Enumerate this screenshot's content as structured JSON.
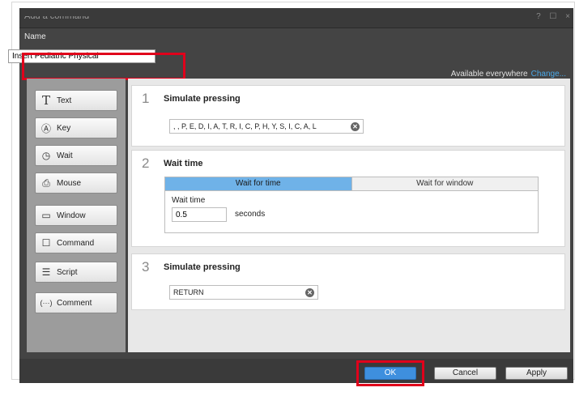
{
  "window": {
    "title": "Add a command",
    "controls": [
      "?",
      "☐",
      "×"
    ]
  },
  "name": {
    "label": "Name",
    "value": "Insert Pediatric Physical"
  },
  "availability": {
    "text": "Available everywhere",
    "change_label": "Change..."
  },
  "sidebar": {
    "items": [
      {
        "label": "Text",
        "icon": "text-icon",
        "glyph": "T"
      },
      {
        "label": "Key",
        "icon": "key-icon",
        "glyph": "Ⓐ"
      },
      {
        "label": "Wait",
        "icon": "clock-icon",
        "glyph": "◷"
      },
      {
        "label": "Mouse",
        "icon": "mouse-icon",
        "glyph": "⎙"
      },
      {
        "label": "Window",
        "icon": "window-icon",
        "glyph": "▭"
      },
      {
        "label": "Command",
        "icon": "speech-bubble-icon",
        "glyph": "☐"
      },
      {
        "label": "Script",
        "icon": "script-icon",
        "glyph": "☰"
      },
      {
        "label": "Comment",
        "icon": "comment-icon",
        "glyph": "(···)"
      }
    ]
  },
  "steps": [
    {
      "number": "1",
      "title": "Simulate pressing",
      "keys": ", , P, E, D, I, A, T, R, I, C, P, H, Y, S, I, C, A, L"
    },
    {
      "number": "2",
      "title": "Wait time",
      "tabs": [
        "Wait for time",
        "Wait for window"
      ],
      "active_tab": "Wait for time",
      "wait_label": "Wait time",
      "wait_value": "0.5",
      "wait_unit": "seconds"
    },
    {
      "number": "3",
      "title": "Simulate pressing",
      "keys": "RETURN"
    }
  ],
  "footer": {
    "ok_label": "OK",
    "cancel_label": "Cancel",
    "apply_label": "Apply"
  },
  "colors": {
    "highlight": "#e0001b",
    "accent": "#3e8fde",
    "link": "#49a7e6",
    "tab_active": "#6fb2e8"
  }
}
